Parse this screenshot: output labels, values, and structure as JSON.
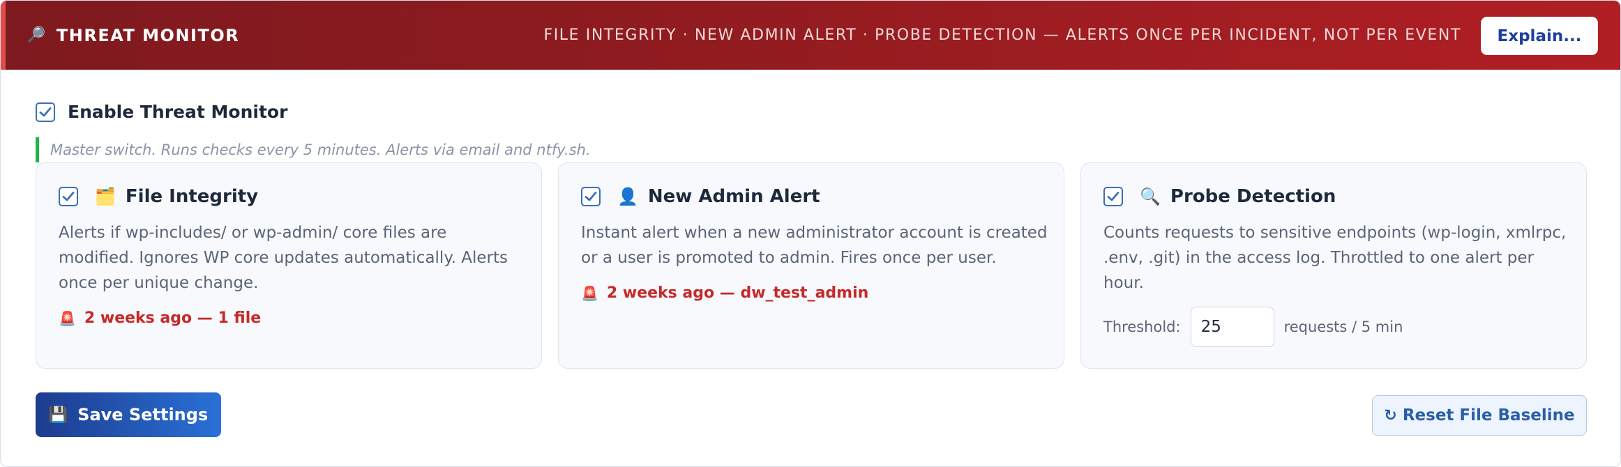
{
  "header": {
    "title": "THREAT MONITOR",
    "icon": "magnifier-icon",
    "tagline": "FILE INTEGRITY · NEW ADMIN ALERT · PROBE DETECTION — ALERTS ONCE PER INCIDENT, NOT PER EVENT",
    "explain_label": "Explain..."
  },
  "master": {
    "label": "Enable Threat Monitor",
    "checked": true,
    "description": "Master switch. Runs checks every 5 minutes. Alerts via email and ntfy.sh."
  },
  "cards": [
    {
      "title": "File Integrity",
      "icon": "folder-icon",
      "checked": true,
      "description": "Alerts if wp-includes/ or wp-admin/ core files are modified. Ignores WP core updates automatically. Alerts once per unique change.",
      "status": "2 weeks ago — 1 file"
    },
    {
      "title": "New Admin Alert",
      "icon": "user-icon",
      "checked": true,
      "description": "Instant alert when a new administrator account is created or a user is promoted to admin. Fires once per user.",
      "status": "2 weeks ago — dw_test_admin"
    },
    {
      "title": "Probe Detection",
      "icon": "search-icon",
      "checked": true,
      "description": "Counts requests to sensitive endpoints (wp-login, xmlrpc, .env, .git) in the access log. Throttled to one alert per hour.",
      "threshold_label": "Threshold:",
      "threshold_value": "25",
      "threshold_unit": "requests / 5 min"
    }
  ],
  "actions": {
    "save_label": "Save Settings",
    "reset_label": "Reset File Baseline"
  },
  "colors": {
    "header_start": "#7e1a1f",
    "header_end": "#b11f24",
    "alert": "#c62828",
    "primary": "#2a70d6",
    "accent_bar": "#22b24c"
  }
}
